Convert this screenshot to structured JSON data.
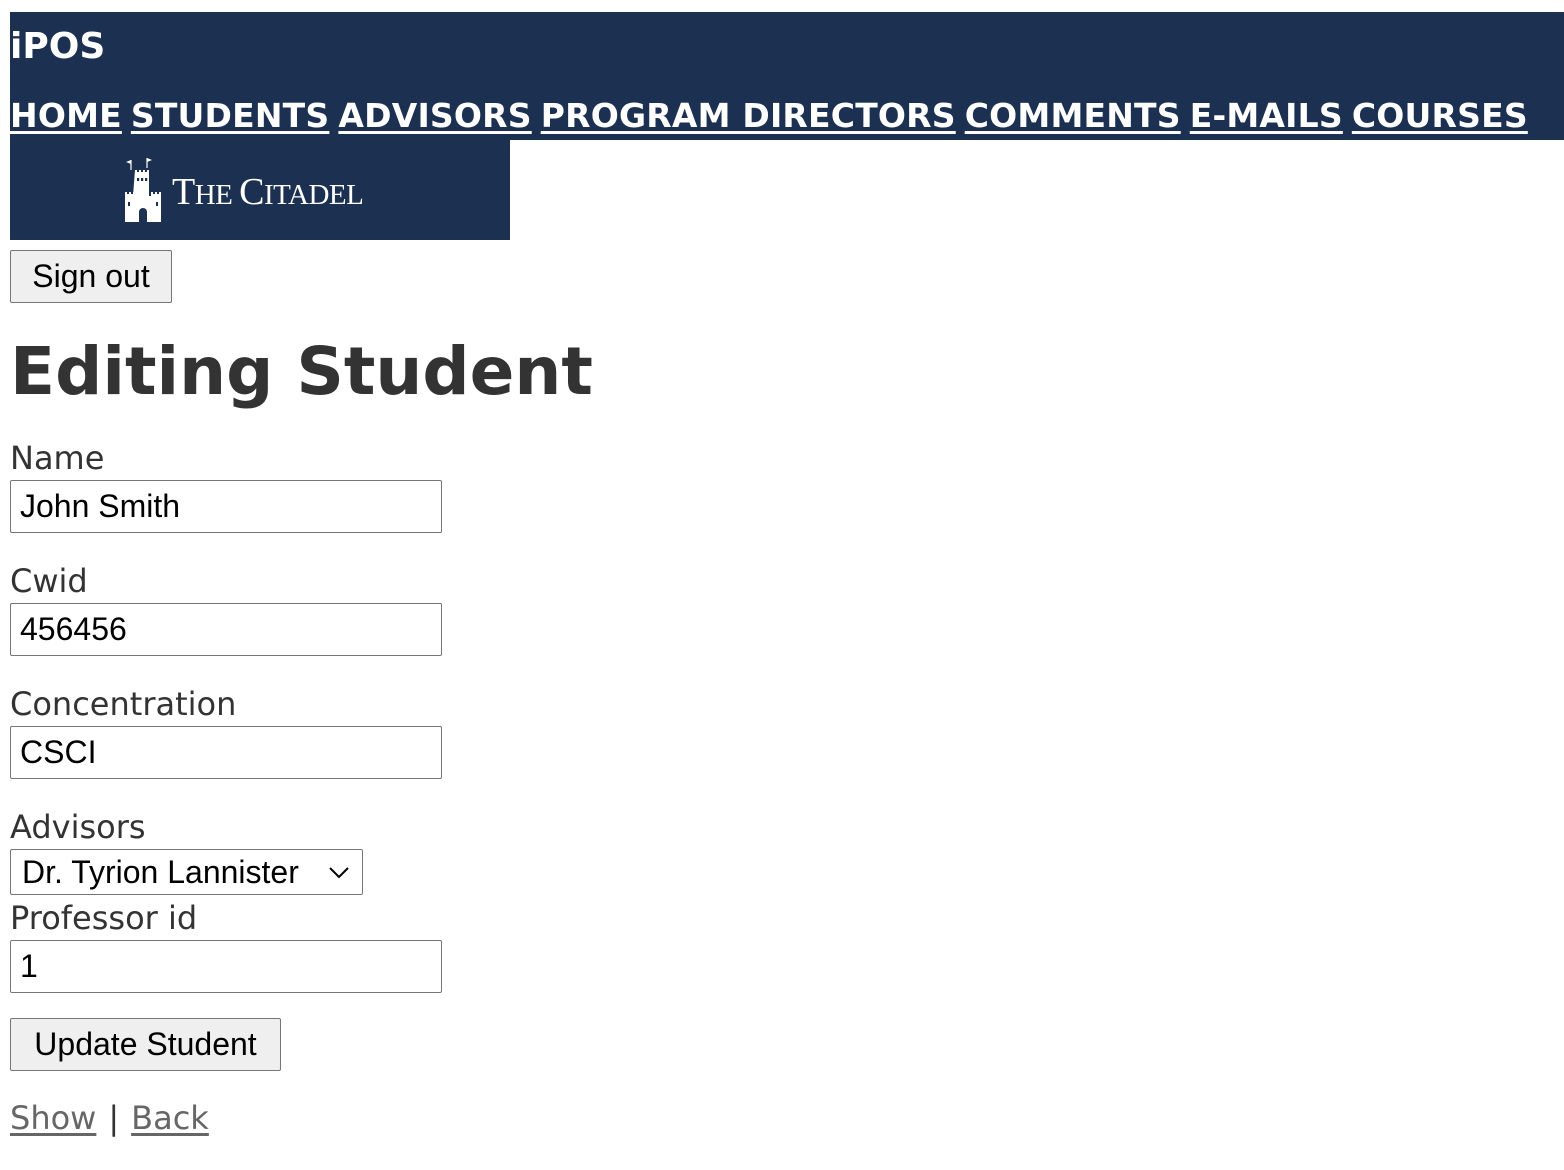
{
  "header": {
    "app_title": "iPOS",
    "nav": [
      {
        "label": "HOME"
      },
      {
        "label": "STUDENTS"
      },
      {
        "label": "ADVISORS"
      },
      {
        "label": "PROGRAM DIRECTORS"
      },
      {
        "label": "COMMENTS"
      },
      {
        "label": "E-MAILS"
      },
      {
        "label": "COURSES"
      }
    ],
    "logo": {
      "first_letter_1": "T",
      "rest_1": "HE ",
      "first_letter_2": "C",
      "rest_2": "ITADEL"
    },
    "colors": {
      "header_bg": "#1c3152",
      "header_text": "#ffffff"
    }
  },
  "auth": {
    "sign_out_label": "Sign out"
  },
  "form": {
    "heading": "Editing Student",
    "name": {
      "label": "Name",
      "value": "John Smith"
    },
    "cwid": {
      "label": "Cwid",
      "value": "456456"
    },
    "concentration": {
      "label": "Concentration",
      "value": "CSCI"
    },
    "advisors": {
      "label": "Advisors",
      "selected": "Dr. Tyrion Lannister"
    },
    "professor_id": {
      "label": "Professor id",
      "value": "1"
    },
    "submit_label": "Update Student"
  },
  "footer_links": {
    "show": "Show",
    "separator": "|",
    "back": "Back"
  }
}
